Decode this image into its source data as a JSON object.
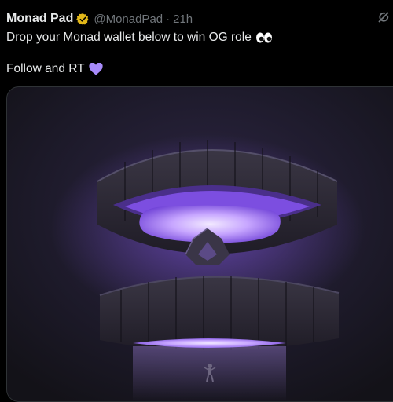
{
  "post": {
    "author_name": "Monad Pad",
    "handle": "@MonadPad",
    "separator": "·",
    "time": "21h",
    "text_line1": "Drop your Monad wallet below to win OG role",
    "text_line2": "Follow and RT"
  },
  "icons": {
    "verified": "verified-badge-icon",
    "grok": "grok-icon",
    "eyes": "eyes-emoji",
    "heart": "purple-heart-emoji"
  },
  "colors": {
    "background": "#000000",
    "text": "#e7e9ea",
    "secondary": "#71767b",
    "verified_gold": "#e2b719",
    "accent_purple": "#8b5cf6"
  }
}
